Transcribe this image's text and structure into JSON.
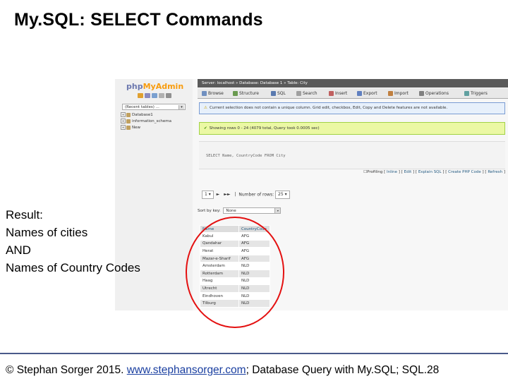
{
  "slide": {
    "title": "My.SQL: SELECT Commands",
    "result_lines": [
      "Result:",
      "Names of cities",
      "AND",
      "Names of Country Codes"
    ],
    "footer": {
      "prefix": "© Stephan Sorger 2015. ",
      "link": "www.stephansorger.com",
      "suffix": "; Database Query with My.SQL;  SQL.28"
    },
    "colors": {
      "highlight_circle": "#e41010",
      "footer_rule": "#4a5a8a"
    }
  },
  "phpmyadmin": {
    "logo_php": "php",
    "logo_myadmin": "MyAdmin",
    "recent_tables": "(Recent tables) ...",
    "databases": [
      "Database1",
      "information_schema",
      "New"
    ],
    "breadcrumb": "Server: localhost » Database: Database 1 » Table: City",
    "tabs": [
      "Browse",
      "Structure",
      "SQL",
      "Search",
      "Insert",
      "Export",
      "Import",
      "Operations",
      "Triggers"
    ],
    "notice": "Current selection does not contain a unique column. Grid edit, checkbox, Edit, Copy and Delete features are not available.",
    "success": "Showing rows 0 - 24 (4079 total, Query took 0.0005 sec)",
    "sql_query": "SELECT Name, CountryCode FROM City",
    "profiling": {
      "checkbox_label": "Profiling",
      "links": [
        "Inline",
        "Edit",
        "Explain SQL",
        "Create PHP Code",
        "Refresh"
      ]
    },
    "pagination": {
      "page": "1",
      "number_of_rows_label": "Number of rows:",
      "number_of_rows": "25"
    },
    "sort_by_key_label": "Sort by key:",
    "sort_by_key_value": "None",
    "table": {
      "columns": [
        "Name",
        "CountryCode"
      ],
      "rows": [
        [
          "Kabul",
          "AFG"
        ],
        [
          "Qandahar",
          "AFG"
        ],
        [
          "Herat",
          "AFG"
        ],
        [
          "Mazar-e-Sharif",
          "AFG"
        ],
        [
          "Amsterdam",
          "NLD"
        ],
        [
          "Rotterdam",
          "NLD"
        ],
        [
          "Haag",
          "NLD"
        ],
        [
          "Utrecht",
          "NLD"
        ],
        [
          "Eindhoven",
          "NLD"
        ],
        [
          "Tilburg",
          "NLD"
        ]
      ]
    }
  }
}
